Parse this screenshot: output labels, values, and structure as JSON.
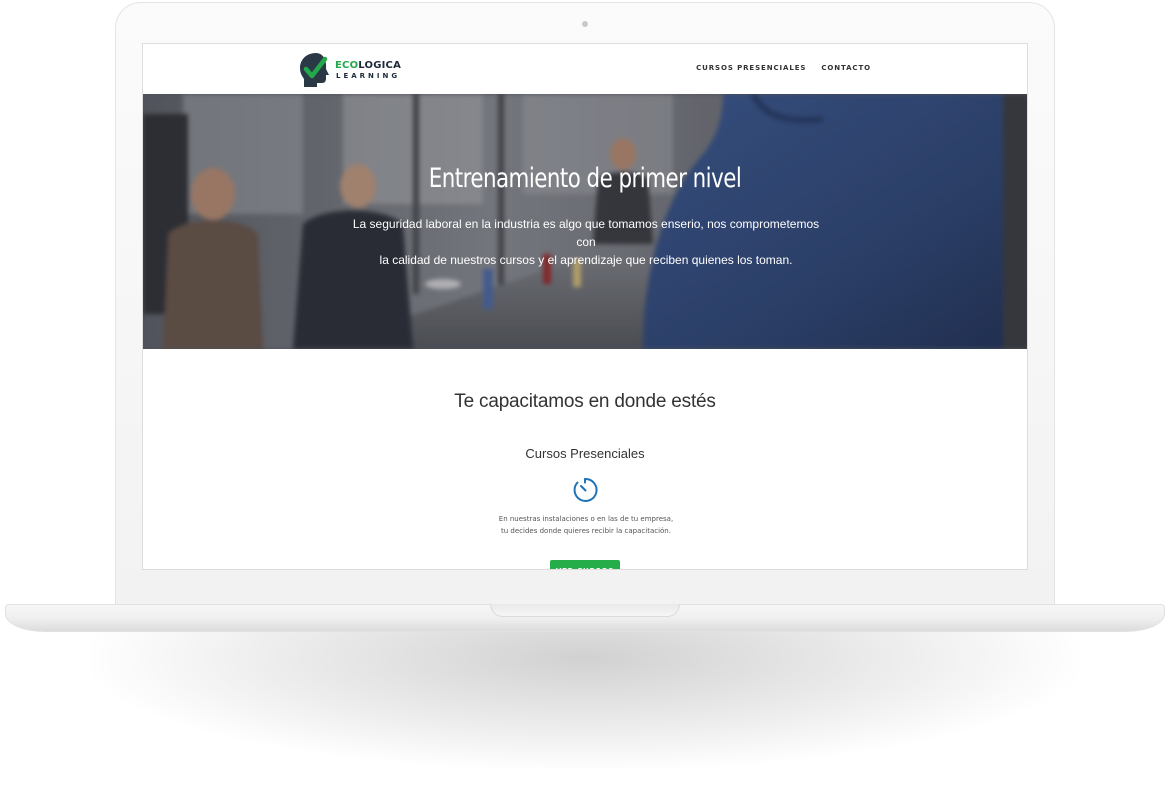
{
  "logo": {
    "word1_prefix": "ECO",
    "word1_suffix": "LOGICA",
    "word2": "LEARNING"
  },
  "nav": {
    "items": [
      {
        "label": "CURSOS PRESENCIALES"
      },
      {
        "label": "CONTACTO"
      }
    ]
  },
  "hero": {
    "title": "Entrenamiento de primer nivel",
    "subtitle_line1": "La seguridad laboral en la industria es algo que tomamos enserio, nos comprometemos con",
    "subtitle_line2": "la calidad de nuestros cursos y el aprendizaje que reciben quienes los toman."
  },
  "section": {
    "title": "Te capacitamos en donde estés"
  },
  "course": {
    "title": "Cursos Presenciales",
    "icon": "clock-icon",
    "desc_line1": "En nuestras instalaciones o en las de tu empresa,",
    "desc_line2": "tu decides donde quieres recibir la capacitación.",
    "button_label": "VER CURSOS"
  },
  "colors": {
    "brand_green": "#24ad49",
    "brand_dark": "#1d2b3a",
    "icon_blue": "#1d72b8"
  }
}
